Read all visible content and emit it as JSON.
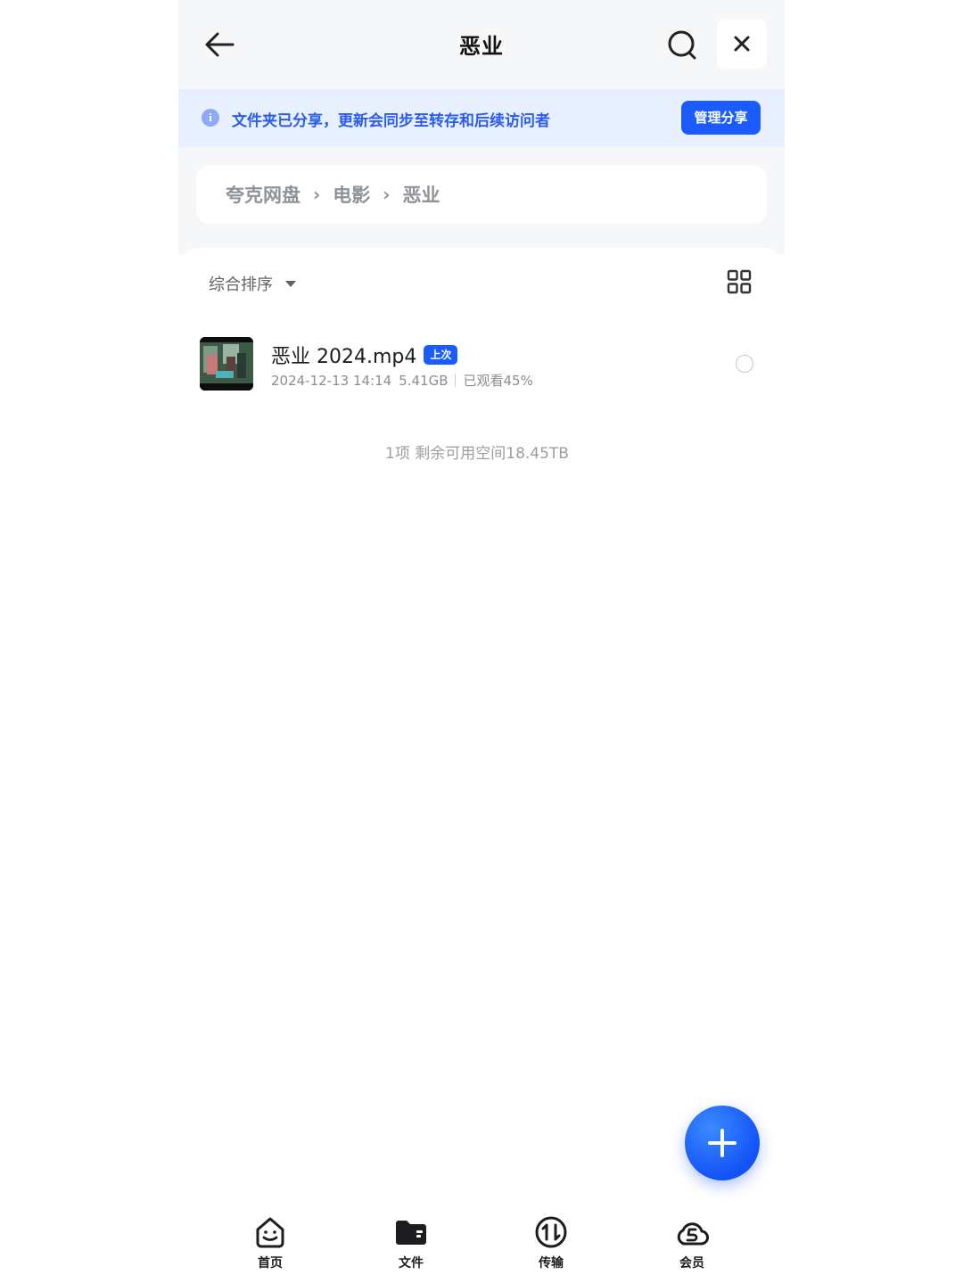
{
  "header": {
    "title": "恶业",
    "back_icon": "back-arrow-icon",
    "search_icon": "search-icon",
    "close_icon": "close-icon"
  },
  "notice": {
    "icon": "info-icon",
    "icon_glyph": "i",
    "text": "文件夹已分享，更新会同步至转存和后续访问者",
    "button_label": "管理分享",
    "accent_color": "#1a5cff"
  },
  "breadcrumb": {
    "items": [
      "夸克网盘",
      "电影",
      "恶业"
    ],
    "separator": "›"
  },
  "list": {
    "sort_label": "综合排序",
    "view_toggle_icon": "grid-view-icon",
    "files": [
      {
        "name": "恶业 2024.mp4",
        "badge": "上次",
        "date": "2024-12-13 14:14",
        "size": "5.41GB",
        "progress_text": "已观看45%",
        "thumbnail": "video-thumbnail"
      }
    ],
    "summary": "1项 剩余可用空间18.45TB"
  },
  "fab": {
    "icon": "plus-icon"
  },
  "bottom_nav": {
    "items": [
      {
        "label": "首页",
        "icon": "home-smile-icon"
      },
      {
        "label": "文件",
        "icon": "folder-icon"
      },
      {
        "label": "传输",
        "icon": "transfer-icon"
      },
      {
        "label": "会员",
        "icon": "member-cloud-icon"
      }
    ]
  }
}
